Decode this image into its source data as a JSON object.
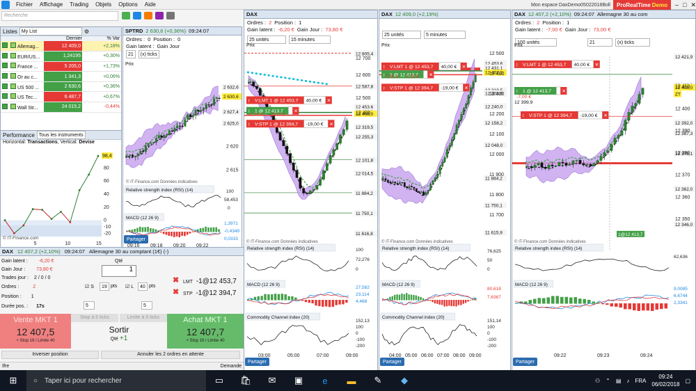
{
  "menu": {
    "items": [
      "Fichier",
      "Affichage",
      "Trading",
      "Objets",
      "Options",
      "Aide"
    ],
    "workspace": "Mon espace DaxDemo05022018Boll",
    "brand_a": "ProRealTime",
    "brand_b": "Demo"
  },
  "search": {
    "placeholder": "Recherche"
  },
  "watchlist": {
    "tab1": "Listes",
    "tab2": "My List",
    "col_last": "Dernier",
    "col_var": "% Var",
    "rows": [
      {
        "name": "Allemag...",
        "last": "12 409,0",
        "var": "+2,18%",
        "color": "#e53935",
        "selected": true
      },
      {
        "name": "EUR/US...",
        "last": "1,24195",
        "var": "+0,30%",
        "color": "#43a047"
      },
      {
        "name": "France ...",
        "last": "5 205,0",
        "var": "+1,73%",
        "color": "#e53935"
      },
      {
        "name": "Or au c...",
        "last": "1 341,3",
        "var": "+0,06%",
        "color": "#43a047"
      },
      {
        "name": "US 500 ...",
        "last": "2 630,6",
        "var": "+0,36%",
        "color": "#43a047"
      },
      {
        "name": "US Tec...",
        "last": "6 487,7",
        "var": "+0,67%",
        "color": "#e53935"
      },
      {
        "name": "Wall Str...",
        "last": "24 015,2",
        "var": "-0,44%",
        "color": "#43a047"
      }
    ]
  },
  "perf": {
    "title": "Performance",
    "scope": "Tous les instruments",
    "desc_a": "Horizontal: ",
    "desc_b": "Transactions",
    "desc_c": ", Vertical: ",
    "desc_d": "Devise",
    "value": "98,4",
    "yticks": [
      "80",
      "60",
      "40",
      "20",
      "0",
      "-10",
      "-20"
    ],
    "xticks": [
      "5",
      "10",
      "15"
    ],
    "copyright": "© IT-Finance.com",
    "points": [
      0,
      -20,
      -8,
      17,
      16,
      2,
      13,
      -3,
      46,
      70,
      98.4
    ]
  },
  "sptrd": {
    "title": "SPTRD",
    "quote": "2 630,6 (+0,36%)",
    "time": "09:24:07",
    "orders": "Ordres :",
    "orders_v": "0",
    "position": "Position :",
    "position_v": "0",
    "gain_latent": "Gain latent :",
    "gain_jour": "Gain Jour",
    "ticks_n": "21",
    "ticks_unit": "(x) ticks",
    "prix": "Prix",
    "prices": [
      "2 632,6",
      "2 630,6",
      "2 627,4",
      "2 625,0"
    ],
    "yticks": [
      "2 620",
      "2 615"
    ],
    "rsi": "Relative strength index (RSI) (14)",
    "rsi_v": [
      "100",
      "58,453",
      "0"
    ],
    "macd": "MACD (12 26 9)",
    "macd_v": [
      "1,3971",
      "-0,4349",
      "0,0333"
    ],
    "xticks": [
      "09:16",
      "09:18",
      "09:20",
      "09:22"
    ],
    "notice": "© IT-Finance.com  Données indicatives",
    "share": "Partager"
  },
  "ticket": {
    "header": "DAX",
    "quote": "12 407,2 (+2,10%)",
    "time": "09:24:07",
    "desc": "Allemagne 30 au comptant (1€) (-)",
    "gain_latent": "Gain latent :",
    "gain_latent_v": "-6,20 €",
    "gain_jour": "Gain Jour :",
    "gain_jour_v": "73,80 €",
    "trades": "Trades jour :",
    "trades_v": "2 / 0 / 0",
    "ordres": "Ordres :",
    "ordres_v": "2",
    "position": "Position :",
    "position_v": "1",
    "duree": "Durée pos. :",
    "duree_v": "17s",
    "qte": "Qté",
    "qty": "1",
    "s_lbl": "S",
    "s_v": "19",
    "l_lbl": "L",
    "l_v": "40",
    "pts": "pts",
    "lmt": "LMT",
    "lmt_v": "-1@12 453,7",
    "stp": "STP",
    "stp_v": "-1@12 394,7",
    "stop5": "Stop à 5 ticks",
    "limit5": "Limite à 5 ticks",
    "spin_a": "5",
    "spin_b": "5",
    "sell": "Vente MKT 1",
    "sell_price": "12 407,5",
    "sell_sub": "+ Stop 19 / Limite 40",
    "exit": "Sortir",
    "exit_q": "Qté",
    "exit_qv": "+1",
    "buy": "Achat MKT 1",
    "buy_price": "12 407,7",
    "buy_sub": "+ Stop 19 / Limite 40",
    "reverse": "Inverser position",
    "cancel": "Annuler les 2 ordres en attente"
  },
  "status": {
    "left": "Ifre",
    "right": "Demande"
  },
  "chart1": {
    "title": "DAX",
    "quote": "12 409,0 (+2,19%)",
    "time": "09:24:07",
    "ordres": "Ordres :",
    "ordres_v": "2",
    "position": "Position :",
    "position_v": "1",
    "gain_latent": "Gain latent :",
    "gain_latent_v": "-6,20 €",
    "gain_jour": "Gain Jour :",
    "gain_jour_v": "73,80 €",
    "units": "25 unités",
    "tf": "15 minutes",
    "prix": "Prix",
    "lmt": "V:LMT 1 @ 12 453,7",
    "lmt_g": "40,00 €",
    "pos": "1 @ 12 413,7",
    "pos_g": "-6,20 €",
    "pos_g2": "-6,20 €",
    "stp": "V:STP 1 @ 12 394,7",
    "stp_g": "-19,00 €",
    "plabels": [
      "12 805,4",
      "12 587,8",
      "12 453,6",
      "12 422,3",
      "12 408,0",
      "12 319,5",
      "12 255,3",
      "12 101,8",
      "12 014,5",
      "11 884,2",
      "11 750,1",
      "11 616,8"
    ],
    "ylbl": [
      "12 700",
      "12 600",
      "12 500",
      "12 400"
    ],
    "rsi": "Relative strength index (RSI) (14)",
    "rsi_v": [
      "100",
      "72,276",
      "0"
    ],
    "macd": "MACD (12 26 9)",
    "macd_v": [
      "27,582",
      "23,114",
      "4,468"
    ],
    "cci": "Commodity Channel index (20)",
    "cci_v": [
      "152,13",
      "100",
      "0",
      "-100",
      "-200"
    ],
    "xticks": [
      "03:00",
      "05:00",
      "07:00",
      "09:00"
    ],
    "notice": "© IT-Finance.com  Données indicatives",
    "share": "Partager"
  },
  "chart2": {
    "title": "DAX",
    "quote": "12 409,0 (+2,19%)",
    "units": "25 unités",
    "tf": "5 minutes",
    "prix": "Prix",
    "lmt": "V:LMT 1 @ 12 453,7",
    "lmt_g": "40,00 €",
    "pos": "1 @ 12 413,7",
    "pos_g": "-7,00 €",
    "pos_g2": "-7,00 €",
    "stp": "V:STP 1 @ 12 394,7",
    "stp_g": "-19,00 €",
    "plabels": [
      "12 453,6",
      "12 431,1",
      "12 407,2",
      "12 319,5",
      "12 304,0",
      "12 240,0",
      "12 158,2",
      "12 048,0",
      "11 884,2",
      "11 750,1",
      "11 615,9"
    ],
    "ylbl": [
      "12 500",
      "12 400",
      "12 300",
      "12 200",
      "12 100",
      "12 000",
      "11 900",
      "11 800",
      "11 700"
    ],
    "rsi": "Relative strength index (RSI) (14)",
    "rsi_v": [
      "76,625",
      "50",
      "0"
    ],
    "macd": "MACD (12 26 9)",
    "macd_v": [
      "80,618",
      "7,6367"
    ],
    "cci": "Commodity Channel index (20)",
    "cci_v": [
      "151,14",
      "100",
      "0",
      "-100",
      "-200"
    ],
    "xticks": [
      "04:00",
      "05:00",
      "06:00",
      "07:00",
      "08:00",
      "09:00"
    ],
    "notice": "© IT-Finance.com  Données indicatives",
    "share": "Partager"
  },
  "chart3": {
    "title": "DAX",
    "quote": "12 407,2 (+2,10%)",
    "time": "09:24:07",
    "desc": "Allemagne 30 au com",
    "ordres": "Ordres :",
    "ordres_v": "2",
    "position": "Position :",
    "position_v": "1",
    "gain_latent": "Gain latent :",
    "gain_latent_v": "-7,00 €",
    "gain_jour": "Gain Jour :",
    "gain_jour_v": "73,00 €",
    "units": "100 unités",
    "ticks_n": "21",
    "ticks_unit": "(x) ticks",
    "prix": "Prix",
    "lmt": "V:LMT 1 @ 12 453,7",
    "lmt_g": "40,00 €",
    "pos": "1 @ 12 413,7",
    "pos_g": "-7,00 €",
    "stp": "V:STP 1 @ 12 394,7",
    "stp_g": "-19,00 €",
    "plabels": [
      "12 421,9",
      "12 408,9",
      "12 408,0",
      "12 392,0",
      "12 387,3",
      "12 378,1",
      "12 362,0",
      "12 346,0"
    ],
    "ylbl": [
      "12 410",
      "12 400",
      "12 390",
      "12 380",
      "12 370",
      "12 360",
      "12 350"
    ],
    "marker": "12 399,9",
    "poslbl": "1@12 413,7",
    "zt": "ZT",
    "rsi": "Relative strength index (RSI) (14)",
    "rsi_v": [
      "62,636"
    ],
    "macd": "MACD (12 26 9)",
    "macd_v": [
      "9,0085",
      "6,6744",
      "2,3341"
    ],
    "xticks": [
      "09:22",
      "09:23",
      "09:24"
    ],
    "notice": "© IT-Finance.com  Données indicatives",
    "share": "Partager"
  },
  "taskbar": {
    "search": "Taper ici pour rechercher",
    "time": "09:24",
    "date": "06/02/2018",
    "lang": "FRA"
  }
}
